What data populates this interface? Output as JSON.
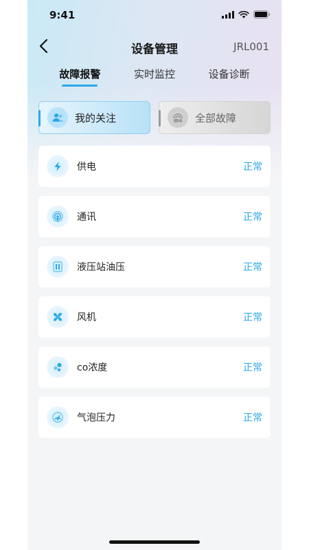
{
  "status_bar": {
    "time": "9:41"
  },
  "nav": {
    "title": "设备管理",
    "device_id": "JRL001"
  },
  "tabs": [
    {
      "label": "故障报警",
      "active": true
    },
    {
      "label": "实时监控",
      "active": false
    },
    {
      "label": "设备诊断",
      "active": false
    }
  ],
  "filters": [
    {
      "label": "我的关注",
      "selected": true,
      "icon": "user-follow-icon"
    },
    {
      "label": "全部故障",
      "selected": false,
      "icon": "fault-all-icon"
    }
  ],
  "items": [
    {
      "label": "供电",
      "status": "正常",
      "icon": "lightning-icon"
    },
    {
      "label": "通讯",
      "status": "正常",
      "icon": "signal-icon"
    },
    {
      "label": "液压站油压",
      "status": "正常",
      "icon": "hydraulic-icon"
    },
    {
      "label": "风机",
      "status": "正常",
      "icon": "fan-icon"
    },
    {
      "label": "co浓度",
      "status": "正常",
      "icon": "gas-icon"
    },
    {
      "label": "气泡压力",
      "status": "正常",
      "icon": "pressure-icon"
    }
  ],
  "colors": {
    "accent": "#2aa7e6",
    "background": "#f4f5f7"
  }
}
